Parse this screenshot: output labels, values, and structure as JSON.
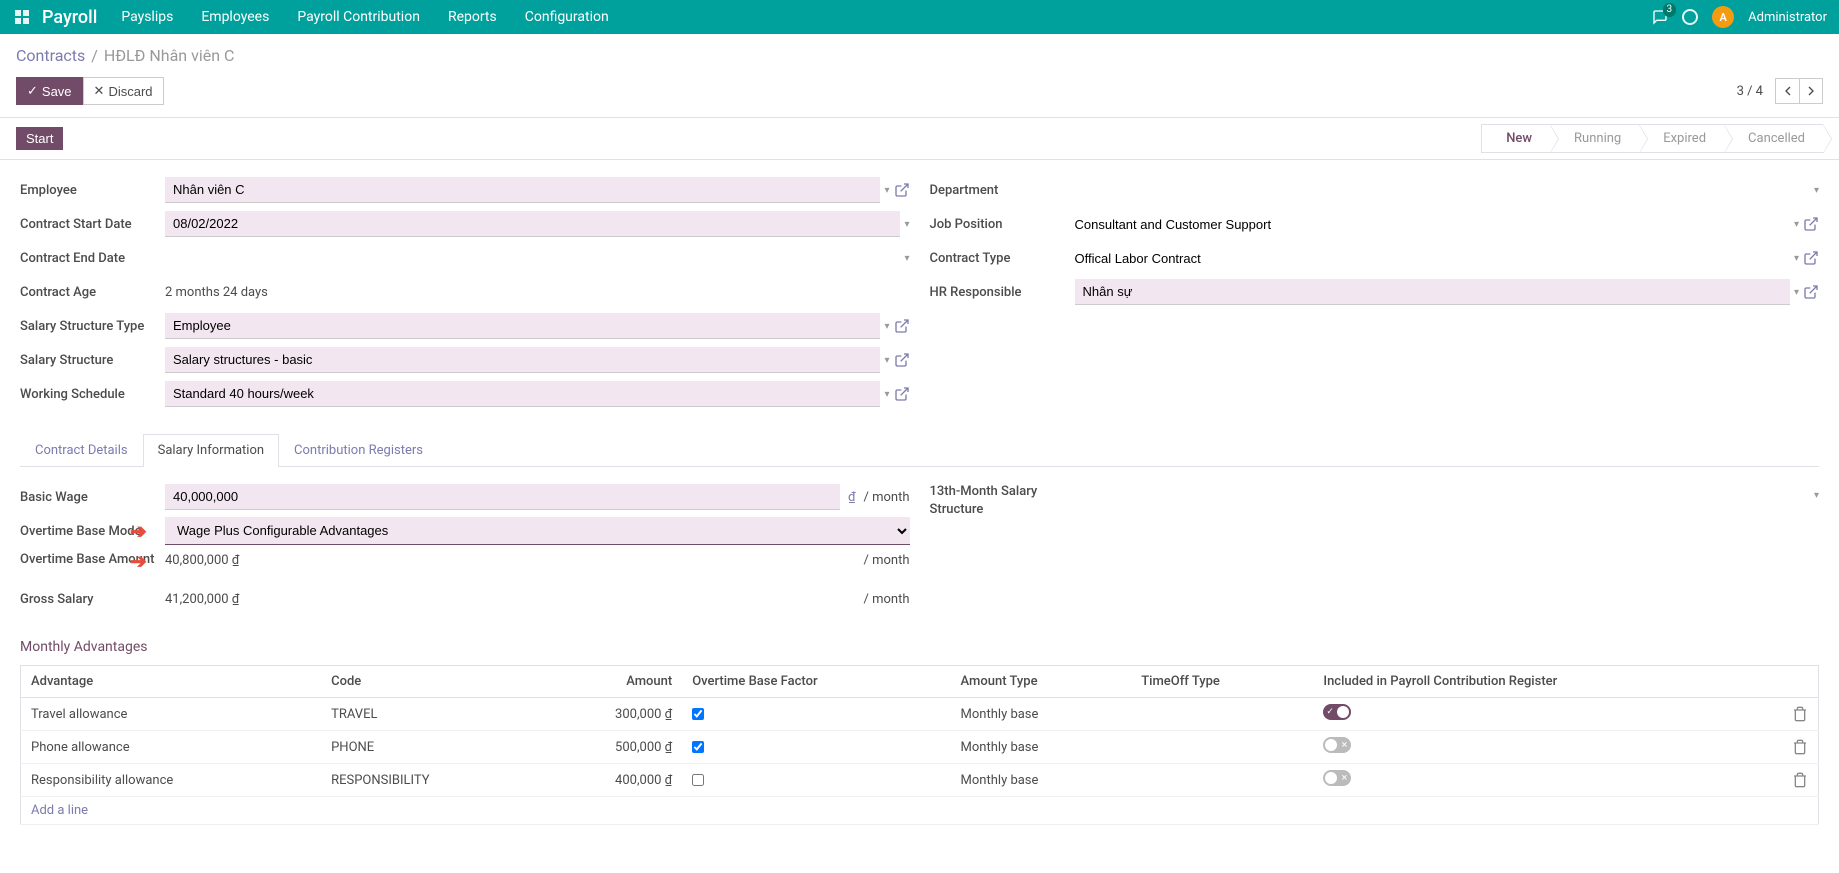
{
  "nav": {
    "brand": "Payroll",
    "items": [
      "Payslips",
      "Employees",
      "Payroll Contribution",
      "Reports",
      "Configuration"
    ],
    "notification_count": "3",
    "user_avatar_letter": "A",
    "user_name": "Administrator"
  },
  "breadcrumb": {
    "root": "Contracts",
    "current": "HĐLĐ Nhân viên C"
  },
  "buttons": {
    "save": "Save",
    "discard": "Discard",
    "start": "Start"
  },
  "pager": {
    "text": "3 / 4"
  },
  "status": {
    "steps": [
      "New",
      "Running",
      "Expired",
      "Cancelled"
    ],
    "active_index": 0
  },
  "form": {
    "labels": {
      "employee": "Employee",
      "contract_start": "Contract Start Date",
      "contract_end": "Contract End Date",
      "contract_age": "Contract Age",
      "salary_struct_type": "Salary Structure Type",
      "salary_struct": "Salary Structure",
      "working_schedule": "Working Schedule",
      "department": "Department",
      "job_position": "Job Position",
      "contract_type": "Contract Type",
      "hr_responsible": "HR Responsible",
      "basic_wage": "Basic Wage",
      "overtime_base_mode": "Overtime Base Mode",
      "overtime_base_amount": "Overtime Base Amount",
      "gross_salary": "Gross Salary",
      "thirteenth": "13th-Month Salary Structure"
    },
    "values": {
      "employee": "Nhân viên C",
      "contract_start": "08/02/2022",
      "contract_end": "",
      "contract_age": "2 months 24 days",
      "salary_struct_type": "Employee",
      "salary_struct": "Salary structures - basic",
      "working_schedule": "Standard 40 hours/week",
      "department": "",
      "job_position": "Consultant and Customer Support",
      "contract_type": "Offical Labor Contract",
      "hr_responsible": "Nhân sự",
      "basic_wage": "40,000,000",
      "overtime_base_mode": "Wage Plus Configurable Advantages",
      "overtime_base_amount": "40,800,000 ₫",
      "gross_salary": "41,200,000 ₫",
      "thirteenth": ""
    },
    "currency": "₫",
    "per_month": "/ month"
  },
  "tabs": {
    "items": [
      "Contract Details",
      "Salary Information",
      "Contribution Registers"
    ],
    "active_index": 1
  },
  "section_monthly": "Monthly Advantages",
  "adv_table": {
    "headers": {
      "advantage": "Advantage",
      "code": "Code",
      "amount": "Amount",
      "overtime_factor": "Overtime Base Factor",
      "amount_type": "Amount Type",
      "timeoff_type": "TimeOff Type",
      "included": "Included in Payroll Contribution Register"
    },
    "rows": [
      {
        "advantage": "Travel allowance",
        "code": "TRAVEL",
        "amount": "300,000 ₫",
        "factor_checked": true,
        "amount_type": "Monthly base",
        "timeoff": "",
        "included": true
      },
      {
        "advantage": "Phone allowance",
        "code": "PHONE",
        "amount": "500,000 ₫",
        "factor_checked": true,
        "amount_type": "Monthly base",
        "timeoff": "",
        "included": false
      },
      {
        "advantage": "Responsibility allowance",
        "code": "RESPONSIBILITY",
        "amount": "400,000 ₫",
        "factor_checked": false,
        "amount_type": "Monthly base",
        "timeoff": "",
        "included": false
      }
    ],
    "add_line": "Add a line"
  }
}
